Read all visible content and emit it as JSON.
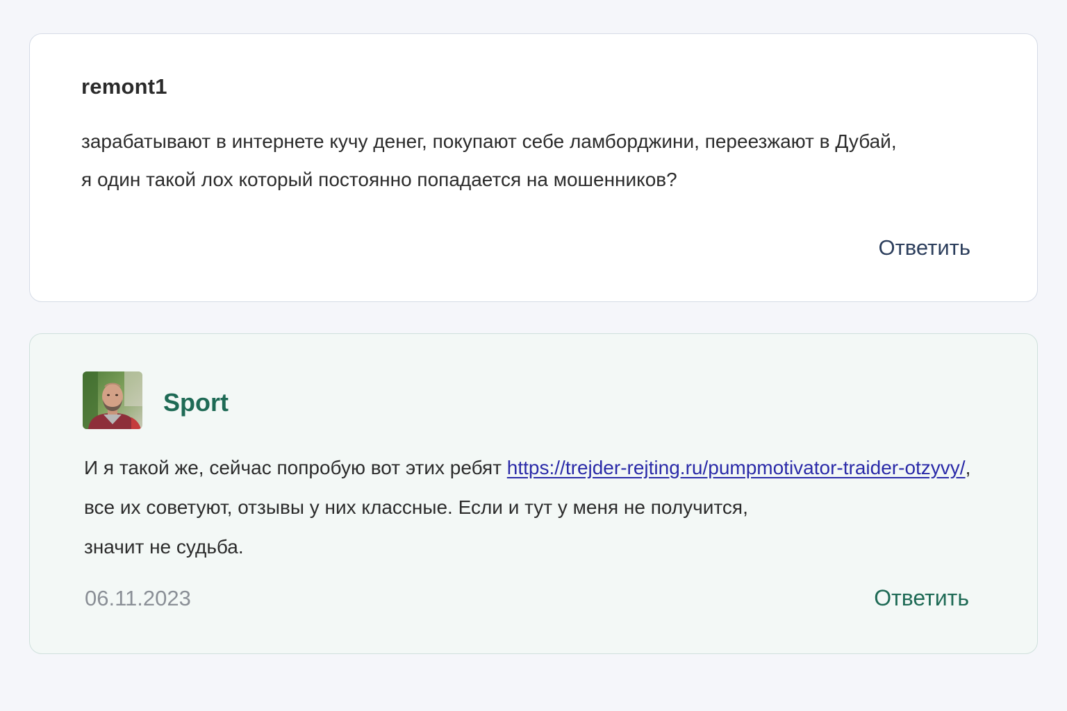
{
  "comments": [
    {
      "author": "remont1",
      "lines": [
        "зарабатывают в интернете кучу денег, покупают себе ламборджини, переезжают в Дубай,",
        "я один такой лох который постоянно попадается на мошенников?"
      ],
      "reply_label": "Ответить"
    },
    {
      "author": "Sport",
      "avatar_icon": "user-photo-avatar",
      "text_before_link": "И я такой же, сейчас попробую вот этих ребят ",
      "link_text": "https://trejder-rejting.ru/pumpmotivator-traider-otzyvy/",
      "text_after_link": ",",
      "line2": "все их советуют, отзывы у них классные. Если и тут у меня не получится,",
      "line3": "значит не судьба.",
      "date": "06.11.2023",
      "reply_label": "Ответить"
    }
  ],
  "colors": {
    "page_bg": "#f5f6fa",
    "accent_green": "#1e6a55",
    "link_blue": "#2a2aa8",
    "reply_dark": "#2c3e5c",
    "date_gray": "#8a8f96"
  }
}
